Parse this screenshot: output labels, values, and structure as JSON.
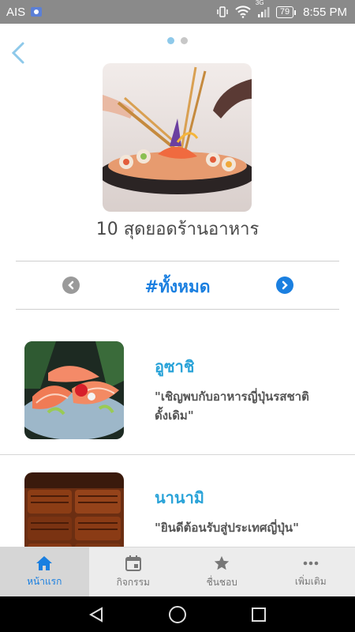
{
  "status_bar": {
    "carrier": "AIS",
    "network_label": "3G",
    "battery_level": "79",
    "time": "8:55 PM"
  },
  "pager": {
    "page_count": 2,
    "active_index": 0
  },
  "header": {
    "title": "10 สุดยอดร้านอาหาร"
  },
  "category": {
    "label": "#ทั้งหมด"
  },
  "restaurants": [
    {
      "name": "อูซาชิ",
      "description": "\"เชิญพบกับอาหารญี่ปุ่นรสชาติดั้งเดิม\""
    },
    {
      "name": "นานามิ",
      "description": "\"ยินดีต้อนรับสู่ประเทศญี่ปุ่น\""
    }
  ],
  "tabs": [
    {
      "label": "หน้าแรก",
      "icon": "home-icon",
      "active": true
    },
    {
      "label": "กิจกรรม",
      "icon": "calendar-icon",
      "active": false
    },
    {
      "label": "ชื่นชอบ",
      "icon": "star-icon",
      "active": false
    },
    {
      "label": "เพิ่มเติม",
      "icon": "more-icon",
      "active": false
    }
  ],
  "colors": {
    "accent": "#1a7fe0",
    "item_title": "#2aa3d8",
    "status_bar": "#8a8a8a"
  }
}
